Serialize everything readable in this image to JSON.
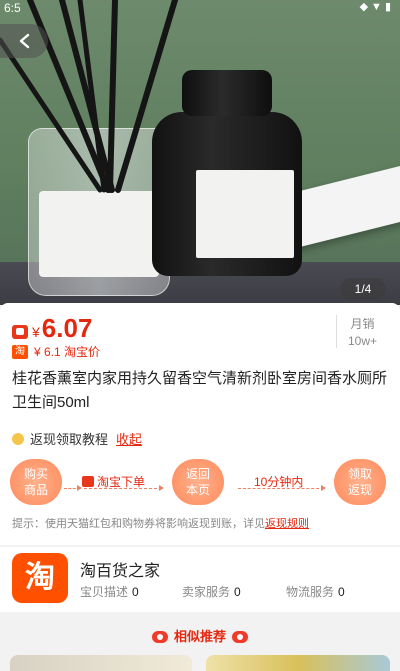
{
  "status_bar": {
    "time": "6:5",
    "icons": "◆▼▮"
  },
  "hero": {
    "image_counter": "1/4"
  },
  "product": {
    "price_currency": "¥",
    "price": "6.07",
    "original_price": "¥ 6.1 淘宝价",
    "tb_badge": "淘",
    "sales_label": "月销",
    "sales_value": "10w+",
    "title": "桂花香薰室内家用持久留香空气清新剂卧室房间香水厕所卫生间50ml",
    "tutorial_label": "返现领取教程",
    "collapse_label": "收起"
  },
  "steps": {
    "step1": "购买\n商品",
    "step2_text": "淘宝下单",
    "step3": "返回\n本页",
    "step4_text": "10分钟内",
    "step5": "领取\n返现"
  },
  "tip": {
    "text": "提示：使用天猫红包和购物券将影响返现到账，详见",
    "link": "返现规则"
  },
  "shop": {
    "logo_text": "淘",
    "name": "淘百货之家",
    "scores": [
      {
        "label": "宝贝描述",
        "value": "0"
      },
      {
        "label": "卖家服务",
        "value": "0"
      },
      {
        "label": "物流服务",
        "value": "0"
      }
    ]
  },
  "similar": {
    "title": "相似推荐"
  },
  "colors": {
    "accent": "#e4280f",
    "taobao_orange": "#ff5000",
    "step_bubble": "#ff8a5c"
  }
}
